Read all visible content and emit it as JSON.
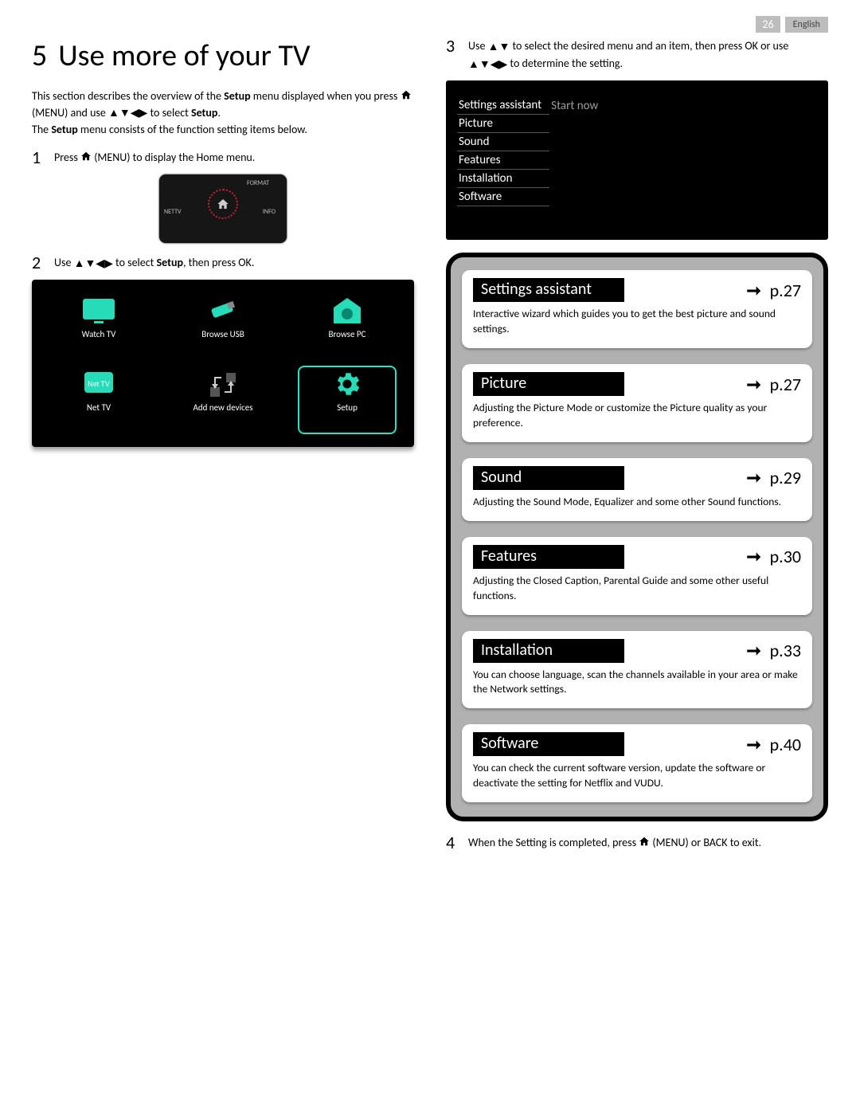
{
  "header": {
    "page_number": "26",
    "language": "English"
  },
  "title": {
    "num": "5",
    "text": "Use more of your TV"
  },
  "intro": {
    "line1a": "This section describes the overview of the ",
    "setup_word": "Setup",
    "line1b": " menu displayed when you press ",
    "menu_word": "(MENU)",
    "line1c": " and use ",
    "line1d": " to select ",
    "line1e": ".",
    "line2a": "The ",
    "line2b": " menu consists of the function setting items below."
  },
  "steps": {
    "s1_num": "1",
    "s1a": "Press ",
    "s1b": " (MENU) to display the Home menu.",
    "s2_num": "2",
    "s2a": "Use ",
    "s2b": " to select ",
    "s2_setup": "Setup",
    "s2c": ", then press OK.",
    "s3_num": "3",
    "s3a": "Use ",
    "s3b": " to select the desired menu and an item, then press OK or use ",
    "s3c": " to determine the setting.",
    "s4_num": "4",
    "s4a": "When the Setting is completed, press ",
    "s4b": " (MENU) or BACK to exit."
  },
  "remote_labels": {
    "format": "FORMAT",
    "nettv": "NETTV",
    "info": "INFO"
  },
  "home_menu": {
    "items": [
      {
        "label": "Watch TV"
      },
      {
        "label": "Browse USB"
      },
      {
        "label": "Browse PC"
      },
      {
        "label": "Net TV"
      },
      {
        "label": "Add new devices"
      },
      {
        "label": "Setup"
      }
    ]
  },
  "settings_menu": {
    "rows": [
      {
        "label": "Settings assistant",
        "value": "Start now"
      },
      {
        "label": "Picture",
        "value": ""
      },
      {
        "label": "Sound",
        "value": ""
      },
      {
        "label": "Features",
        "value": ""
      },
      {
        "label": "Installation",
        "value": ""
      },
      {
        "label": "Software",
        "value": ""
      }
    ]
  },
  "cards": [
    {
      "title": "Settings assistant",
      "page": "p.27",
      "desc": "Interactive wizard which guides you to get the best picture and sound settings."
    },
    {
      "title": "Picture",
      "page": "p.27",
      "desc": "Adjusting the Picture Mode or customize the Picture quality as your preference."
    },
    {
      "title": "Sound",
      "page": "p.29",
      "desc": "Adjusting the Sound Mode, Equalizer and some other Sound functions."
    },
    {
      "title": "Features",
      "page": "p.30",
      "desc": "Adjusting the Closed Caption, Parental Guide and some other useful functions."
    },
    {
      "title": "Installation",
      "page": "p.33",
      "desc": "You can choose language, scan the channels available in your area or make the Network settings."
    },
    {
      "title": "Software",
      "page": "p.40",
      "desc": "You can check the current software version, update the software or deactivate the setting for Netflix and VUDU."
    }
  ]
}
